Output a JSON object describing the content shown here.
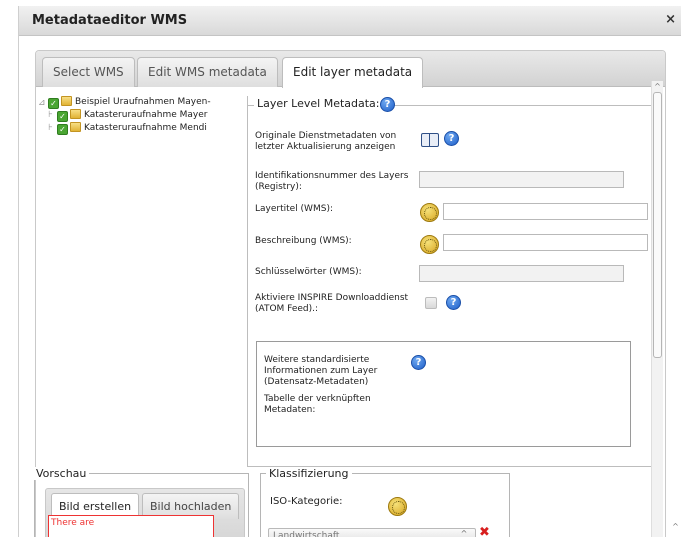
{
  "window": {
    "title": "Metadataeditor WMS",
    "close_glyph": "×"
  },
  "tabs": [
    {
      "label": "Select WMS",
      "active": false
    },
    {
      "label": "Edit WMS metadata",
      "active": false
    },
    {
      "label": "Edit layer metadata",
      "active": true
    }
  ],
  "tree": {
    "root": {
      "label": "Beispiel Uraufnahmen Mayen-",
      "checked": true
    },
    "children": [
      {
        "label": "Katasteruraufnahme Mayer",
        "checked": true
      },
      {
        "label": "Katasteruraufnahme Mendi",
        "checked": true
      }
    ]
  },
  "layer_metadata": {
    "legend": "Layer Level Metadata:",
    "original_metadata_label": "Originale Dienstmetadaten von letzter Aktualisierung anzeigen",
    "id_label": "Identifikationsnummer des Layers (Registry):",
    "id_value": "",
    "title_label": "Layertitel (WMS):",
    "title_value": "",
    "description_label": "Beschreibung (WMS):",
    "description_value": "",
    "keywords_label": "Schlüsselwörter (WMS):",
    "keywords_value": "",
    "inspire_label": "Aktiviere INSPIRE Downloaddienst (ATOM Feed).:",
    "inspire_checked": false,
    "further_info_label": "Weitere standardisierte Informationen zum Layer (Datensatz-Metadaten)",
    "linked_table_label": "Tabelle der verknüpften Metadaten:"
  },
  "preview": {
    "legend": "Vorschau",
    "tabs": [
      {
        "label": "Bild erstellen",
        "active": true
      },
      {
        "label": "Bild hochladen",
        "active": false
      }
    ],
    "error_text": "There are"
  },
  "classification": {
    "legend": "Klassifizierung",
    "iso_label": "ISO-Kategorie:",
    "selected_category": "Landwirtschaft"
  },
  "icons": {
    "help": "help-icon",
    "book": "book-icon",
    "language": "language-icon",
    "remove": "remove-icon"
  },
  "colors": {
    "help_blue": "#1f5fc9",
    "check_green": "#4aa532",
    "error_red": "#e33333"
  }
}
